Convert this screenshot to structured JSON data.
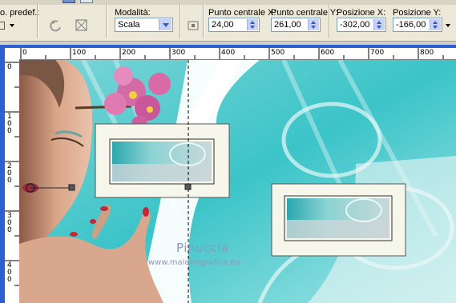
{
  "toolbar": {
    "preset_label": "o. predef.:",
    "mode_label": "Modalità:",
    "mode_value": "Scala",
    "center_x_label": "Punto centrale X:",
    "center_x_value": "24,00",
    "center_y_label": "Punto centrale Y:",
    "center_y_value": "261,00",
    "pos_x_label": "Posizione X:",
    "pos_x_value": "-302,00",
    "pos_y_label": "Posizione Y:",
    "pos_y_value": "-166,00"
  },
  "ruler": {
    "top_ticks": [
      "0",
      "100",
      "200",
      "300",
      "400",
      "500",
      "600",
      "700",
      "800"
    ],
    "left_ticks": [
      "0",
      "1\n0\n0",
      "2\n0\n0",
      "3\n0\n0",
      "4\n0\n0"
    ]
  },
  "watermark": {
    "name": "Pinuccia",
    "url": "www.maidiregrafica.eu"
  },
  "colors": {
    "accent": "#2d5fd0",
    "teal": "#3bc4c8"
  }
}
